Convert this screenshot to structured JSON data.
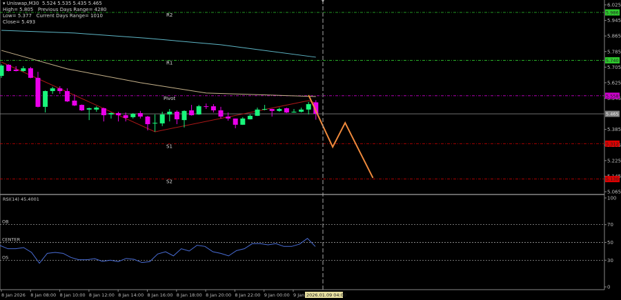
{
  "header": {
    "symbol_line": "Uniswap,M30  5.524 5.535 5.435 5.465",
    "high": "High= 5.805",
    "prev_range": "Previous Days Range= 4280",
    "low": "Low= 5.377",
    "curr_range": "Current Days Range= 1010",
    "close": "Close= 5.493"
  },
  "colors": {
    "background": "#000000",
    "bull": "#19f57b",
    "bear": "#ea00ea",
    "ma_fast": "#5fb8c8",
    "ma_slow": "#c8b48c",
    "zigzag": "#b01818",
    "projection": "#f08a3c",
    "rsi": "#4a6ed8"
  },
  "chart_data": [
    {
      "type": "candlestick",
      "title": "Uniswap,M30",
      "ylim": [
        5.065,
        6.025
      ],
      "y_ticks": [
        "6.025",
        "5.945",
        "5.865",
        "5.785",
        "5.705",
        "5.625",
        "5.545",
        "5.385",
        "5.305",
        "5.225",
        "5.145",
        "5.065"
      ],
      "x_ticks": [
        "8 Jan 2026",
        "8 Jan 08:00",
        "8 Jan 10:00",
        "8 Jan 12:00",
        "8 Jan 14:00",
        "8 Jan 16:00",
        "8 Jan 18:00",
        "8 Jan 20:00",
        "8 Jan 22:00",
        "9 Jan 00:00",
        "9 Jan"
      ],
      "crosshair_time": "2026.01.09 04:00",
      "ohlc": [
        [
          5.66,
          5.72,
          5.65,
          5.713
        ],
        [
          5.717,
          5.72,
          5.683,
          5.685
        ],
        [
          5.692,
          5.71,
          5.683,
          5.685
        ],
        [
          5.685,
          5.71,
          5.681,
          5.699
        ],
        [
          5.699,
          5.706,
          5.648,
          5.65
        ],
        [
          5.65,
          5.681,
          5.498,
          5.501
        ],
        [
          5.501,
          5.585,
          5.472,
          5.582
        ],
        [
          5.582,
          5.604,
          5.568,
          5.596
        ],
        [
          5.596,
          5.607,
          5.568,
          5.582
        ],
        [
          5.582,
          5.596,
          5.526,
          5.529
        ],
        [
          5.533,
          5.565,
          5.505,
          5.508
        ],
        [
          5.511,
          5.513,
          5.48,
          5.483
        ],
        [
          5.487,
          5.497,
          5.433,
          5.494
        ],
        [
          5.487,
          5.504,
          5.476,
          5.497
        ],
        [
          5.494,
          5.497,
          5.426,
          5.458
        ],
        [
          5.462,
          5.472,
          5.441,
          5.469
        ],
        [
          5.469,
          5.476,
          5.426,
          5.458
        ],
        [
          5.458,
          5.472,
          5.426,
          5.444
        ],
        [
          5.448,
          5.469,
          5.441,
          5.465
        ],
        [
          5.469,
          5.48,
          5.441,
          5.451
        ],
        [
          5.451,
          5.455,
          5.38,
          5.412
        ],
        [
          5.416,
          5.462,
          5.373,
          5.419
        ],
        [
          5.416,
          5.476,
          5.402,
          5.462
        ],
        [
          5.462,
          5.49,
          5.426,
          5.476
        ],
        [
          5.476,
          5.483,
          5.412,
          5.437
        ],
        [
          5.433,
          5.483,
          5.395,
          5.48
        ],
        [
          5.483,
          5.511,
          5.456,
          5.458
        ],
        [
          5.462,
          5.511,
          5.46,
          5.504
        ],
        [
          5.504,
          5.518,
          5.49,
          5.501
        ],
        [
          5.504,
          5.515,
          5.472,
          5.483
        ],
        [
          5.483,
          5.501,
          5.441,
          5.451
        ],
        [
          5.451,
          5.472,
          5.43,
          5.441
        ],
        [
          5.441,
          5.441,
          5.391,
          5.409
        ],
        [
          5.409,
          5.448,
          5.408,
          5.441
        ],
        [
          5.437,
          5.462,
          5.436,
          5.455
        ],
        [
          5.455,
          5.497,
          5.454,
          5.487
        ],
        [
          5.487,
          5.511,
          5.483,
          5.49
        ],
        [
          5.49,
          5.491,
          5.451,
          5.48
        ],
        [
          5.48,
          5.497,
          5.476,
          5.49
        ],
        [
          5.494,
          5.497,
          5.469,
          5.472
        ],
        [
          5.472,
          5.49,
          5.471,
          5.476
        ],
        [
          5.476,
          5.497,
          5.472,
          5.487
        ],
        [
          5.487,
          5.526,
          5.462,
          5.515
        ],
        [
          5.524,
          5.535,
          5.435,
          5.465
        ]
      ],
      "ma_fast": [
        [
          0,
          5.894
        ],
        [
          10,
          5.88
        ],
        [
          20,
          5.853
        ],
        [
          30,
          5.82
        ],
        [
          43,
          5.756
        ]
      ],
      "ma_slow": [
        [
          0,
          5.791
        ],
        [
          9,
          5.696
        ],
        [
          19,
          5.625
        ],
        [
          28,
          5.572
        ],
        [
          43,
          5.554
        ]
      ],
      "zigzag": [
        [
          0,
          5.731
        ],
        [
          21,
          5.373
        ],
        [
          42,
          5.533
        ],
        [
          43,
          5.52
        ]
      ],
      "projection": [
        [
          42,
          5.561
        ],
        [
          45.3,
          5.295
        ],
        [
          47,
          5.419
        ],
        [
          50.8,
          5.136
        ]
      ],
      "levels": [
        {
          "name": "R2",
          "value": "5.986",
          "price": 5.986,
          "color": "#2ecc2e"
        },
        {
          "name": "R1",
          "value": "5.740",
          "price": 5.74,
          "color": "#2ecc2e"
        },
        {
          "name": "Pivot",
          "value": "5.558",
          "price": 5.558,
          "color": "#cc00cc"
        },
        {
          "name": "S1",
          "value": "5.312",
          "price": 5.312,
          "color": "#e00000"
        },
        {
          "name": "S2",
          "value": "5.130",
          "price": 5.13,
          "color": "#e00000"
        }
      ],
      "current_price": {
        "value": "5.465",
        "price": 5.465,
        "color": "#808080"
      }
    },
    {
      "type": "line",
      "title": "RSI(14) 45.4001",
      "ylim": [
        0,
        100
      ],
      "y_ticks": [
        "100",
        "70",
        "50",
        "30",
        "0"
      ],
      "bands": [
        {
          "label": "OB",
          "value": 70
        },
        {
          "label": "CENTER",
          "value": 50
        },
        {
          "label": "OS",
          "value": 30
        }
      ],
      "values": [
        46.5,
        42.9,
        42.9,
        44.2,
        38.8,
        26.6,
        37.7,
        38.8,
        37.7,
        33.1,
        30.5,
        30.5,
        31.8,
        28.7,
        30.0,
        28.4,
        32.0,
        31.0,
        27.4,
        28.4,
        37.0,
        39.5,
        34.9,
        42.9,
        40.3,
        46.8,
        45.5,
        39.5,
        37.7,
        34.9,
        40.8,
        42.9,
        48.6,
        48.6,
        47.3,
        48.6,
        45.5,
        45.5,
        48.1,
        54.5,
        45.4
      ]
    }
  ]
}
